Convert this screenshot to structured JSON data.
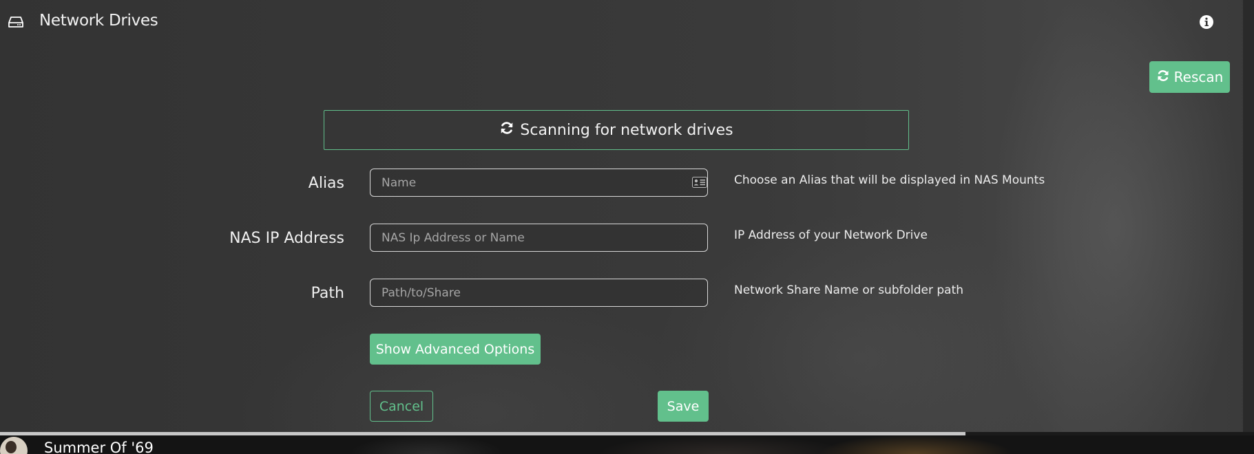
{
  "header": {
    "title": "Network Drives",
    "drive_icon": "hard-drive-icon",
    "info_icon": "info-circle-icon"
  },
  "toolbar": {
    "rescan_label": "Rescan",
    "rescan_icon": "refresh-icon"
  },
  "scan_status": {
    "text": "Scanning for network drives",
    "icon": "refresh-icon"
  },
  "form": {
    "alias": {
      "label": "Alias",
      "placeholder": "Name",
      "value": "",
      "help": "Choose an Alias that will be displayed in NAS Mounts",
      "icon": "contact-card-icon"
    },
    "ip": {
      "label": "NAS IP Address",
      "placeholder": "NAS Ip Address or Name",
      "value": "",
      "help": "IP Address of your Network Drive"
    },
    "path": {
      "label": "Path",
      "placeholder": "Path/to/Share",
      "value": "",
      "help": "Network Share Name or subfolder path"
    },
    "advanced_label": "Show Advanced Options",
    "cancel_label": "Cancel",
    "save_label": "Save"
  },
  "player": {
    "track_title": "Summer Of '69",
    "progress": 0.77
  },
  "colors": {
    "accent": "#62c08c",
    "background": "#363636",
    "text": "#ffffff"
  }
}
